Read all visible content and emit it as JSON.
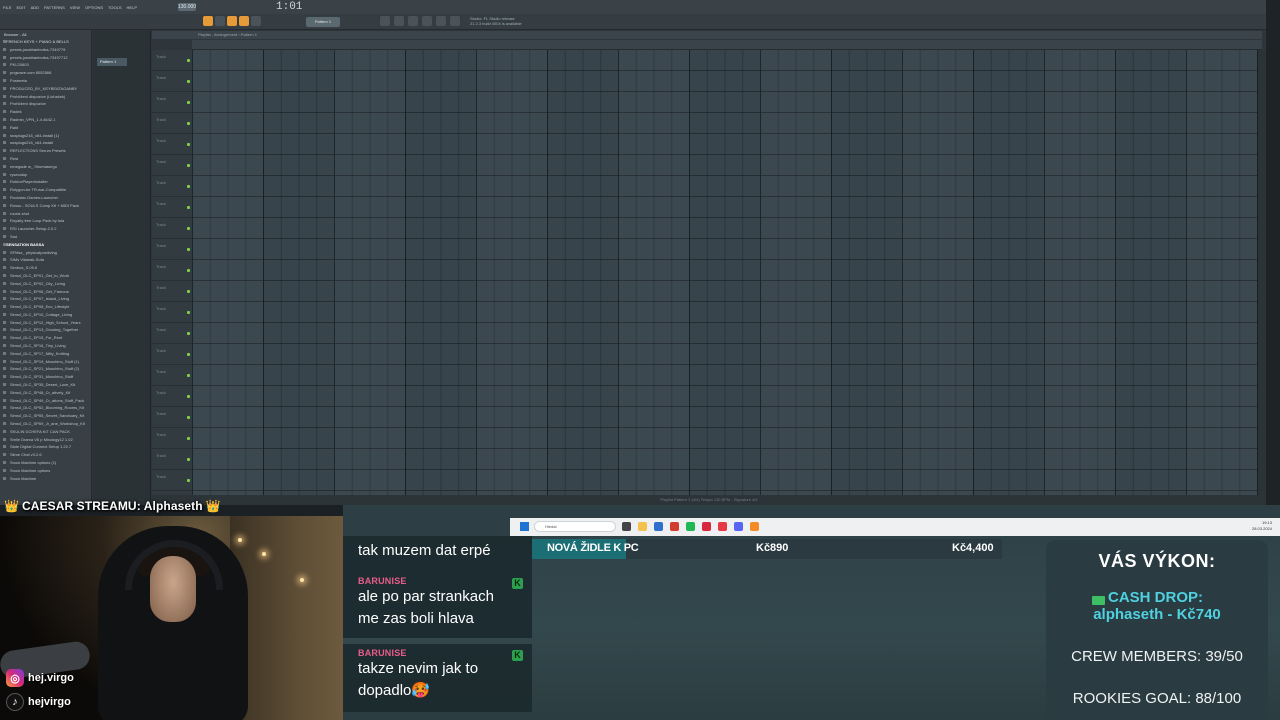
{
  "fl_studio": {
    "menus": [
      "File",
      "Edit",
      "Add",
      "Patterns",
      "View",
      "Options",
      "Tools",
      "Help"
    ],
    "tempo": "130.000",
    "song_time": "1:01",
    "pattern_label": "Pattern 1",
    "hint_text_1": "Studio: FL Studio release",
    "hint_text_2": "21.2.3 build 4004 is available",
    "playlist_title": "Playlist - Arrangement › Pattern 1",
    "picker_pattern": "Pattern 1",
    "browser_title": "Browser - All",
    "browser_items": [
      {
        "label": "FRENCH KEYS + PIANO & BELLS",
        "folder": true
      },
      {
        "label": "pexels-jonathanborba-7349779"
      },
      {
        "label": "pexels-jonathanborba-73497712"
      },
      {
        "label": "PKL20603"
      },
      {
        "label": "pngwave.com 8052568"
      },
      {
        "label": "Postmeta"
      },
      {
        "label": "PRODUCED_BY_KEYBEATAGANBY"
      },
      {
        "label": "Prohlížení dispozice (Lichaček)"
      },
      {
        "label": "Prohlížení dispozice"
      },
      {
        "label": "Radek"
      },
      {
        "label": "Radmin_VPN_1.4.4642.1"
      },
      {
        "label": "Raid"
      },
      {
        "label": "snaplugs216_x64-install (1)"
      },
      {
        "label": "snaplugs216_x64-install"
      },
      {
        "label": "REFLECTIONS Serum Presets"
      },
      {
        "label": "Rest"
      },
      {
        "label": "renegade w_ Shumasergo"
      },
      {
        "label": "rysecalap"
      },
      {
        "label": "RobloxPlayerInstaller"
      },
      {
        "label": "Rolygon-be TR-war-Compatible"
      },
      {
        "label": "Rockstar-Games-Launcher"
      },
      {
        "label": "Rosso - SOULS Comp Kit + MIDI Pack"
      },
      {
        "label": "round-shot"
      },
      {
        "label": "Royalty free Loop Pack by tula"
      },
      {
        "label": "RSI Launcher-Setup-2.0.2"
      },
      {
        "label": "Sad"
      },
      {
        "label": "SENSATION BASSA",
        "folder": true,
        "highlight": true
      },
      {
        "label": "SFMsx_ physicalpositiving"
      },
      {
        "label": "SIMs Vilamak-Sofa"
      },
      {
        "label": "Simbus_S.09.6"
      },
      {
        "label": "Sims4_DLC_EP01_Get_to_Work"
      },
      {
        "label": "Sims4_DLC_EP02_City_Living"
      },
      {
        "label": "Sims4_DLC_EP06_Get_Famous"
      },
      {
        "label": "Sims4_DLC_EP07_Island_Living"
      },
      {
        "label": "Sims4_DLC_EP08_Eco_Lifestyle"
      },
      {
        "label": "Sims4_DLC_EP10_Cottage_Living"
      },
      {
        "label": "Sims4_DLC_EP12_High_School_Years"
      },
      {
        "label": "Sims4_DLC_EP13_Growing_Together"
      },
      {
        "label": "Sims4_DLC_EP15_For_Rent"
      },
      {
        "label": "Sims4_DLC_SP16_Tiny_Living"
      },
      {
        "label": "Sims4_DLC_SP17_Nifty_Knitting"
      },
      {
        "label": "Sims4_DLC_SP19_Moschino_Stuff (1)"
      },
      {
        "label": "Sims4_DLC_SP21_Moschino_Stuff (2)"
      },
      {
        "label": "Sims4_DLC_SP31_Moschino_Stuff"
      },
      {
        "label": "Sims4_DLC_SP35_Desert_Luxe_Kit"
      },
      {
        "label": "Sims4_DLC_SP48_Cr_atively_Kit"
      },
      {
        "label": "Sims4_DLC_SP49_Cr_ations_Stuff_Pack"
      },
      {
        "label": "Sims4_DLC_SP52_Blooming_Rooms_Kit"
      },
      {
        "label": "Sims4_DLC_SP55_Secret_Sanctuary_Kit"
      },
      {
        "label": "Sims4_DLC_SP69_Jr_ane_Workshop_Kit"
      },
      {
        "label": "SKULIN DCHEFA KIT CAN PACK"
      },
      {
        "label": "Smile Drama V6 p Mixology12 1.02"
      },
      {
        "label": "Slate Digital Connect Setup 1.22.7"
      },
      {
        "label": "Slime Chat v3.2.6"
      },
      {
        "label": "Snow Machine options (1)"
      },
      {
        "label": "Snow Machine options"
      },
      {
        "label": "Snow Machine"
      }
    ],
    "track_label": "Track",
    "status_text": "Playlist Pattern 1 (4/4) Tempo 130 BPM - Signature 4/4"
  },
  "overlay": {
    "caesar_text": "CAESAR STREAMU: Alphaseth",
    "crown_glyph": "👑",
    "instagram_handle": "hej.virgo",
    "tiktok_handle": "hejvirgo"
  },
  "taskbar": {
    "search_placeholder": "Hledat",
    "clock_time": "19:13",
    "clock_date": "28.03.2024"
  },
  "chat": {
    "messages": [
      {
        "user": "",
        "text": "tak muzem dat erpé",
        "badge": false
      },
      {
        "user": "BARUNISE",
        "text": "ale po par strankach me zas boli hlava",
        "badge": true
      },
      {
        "user": "BARUNISE",
        "text": "takze nevim jak to dopadlo",
        "badge": true
      }
    ],
    "badge_glyph": "K",
    "emoji_glyph": "🥵"
  },
  "goal": {
    "name": "NOVÁ ŽIDLE K PC",
    "current": "Kč890",
    "target": "Kč4,400",
    "progress_fraction": 0.2,
    "fill_color": "#1a6e74"
  },
  "stats": {
    "title": "VÁS VÝKON:",
    "cash_label": "CASH DROP:",
    "cash_value": "alphaseth - Kč740",
    "crew": "CREW MEMBERS: 39/50",
    "rookies": "ROOKIES GOAL: 88/100",
    "accent_color": "#4fd1e0"
  }
}
